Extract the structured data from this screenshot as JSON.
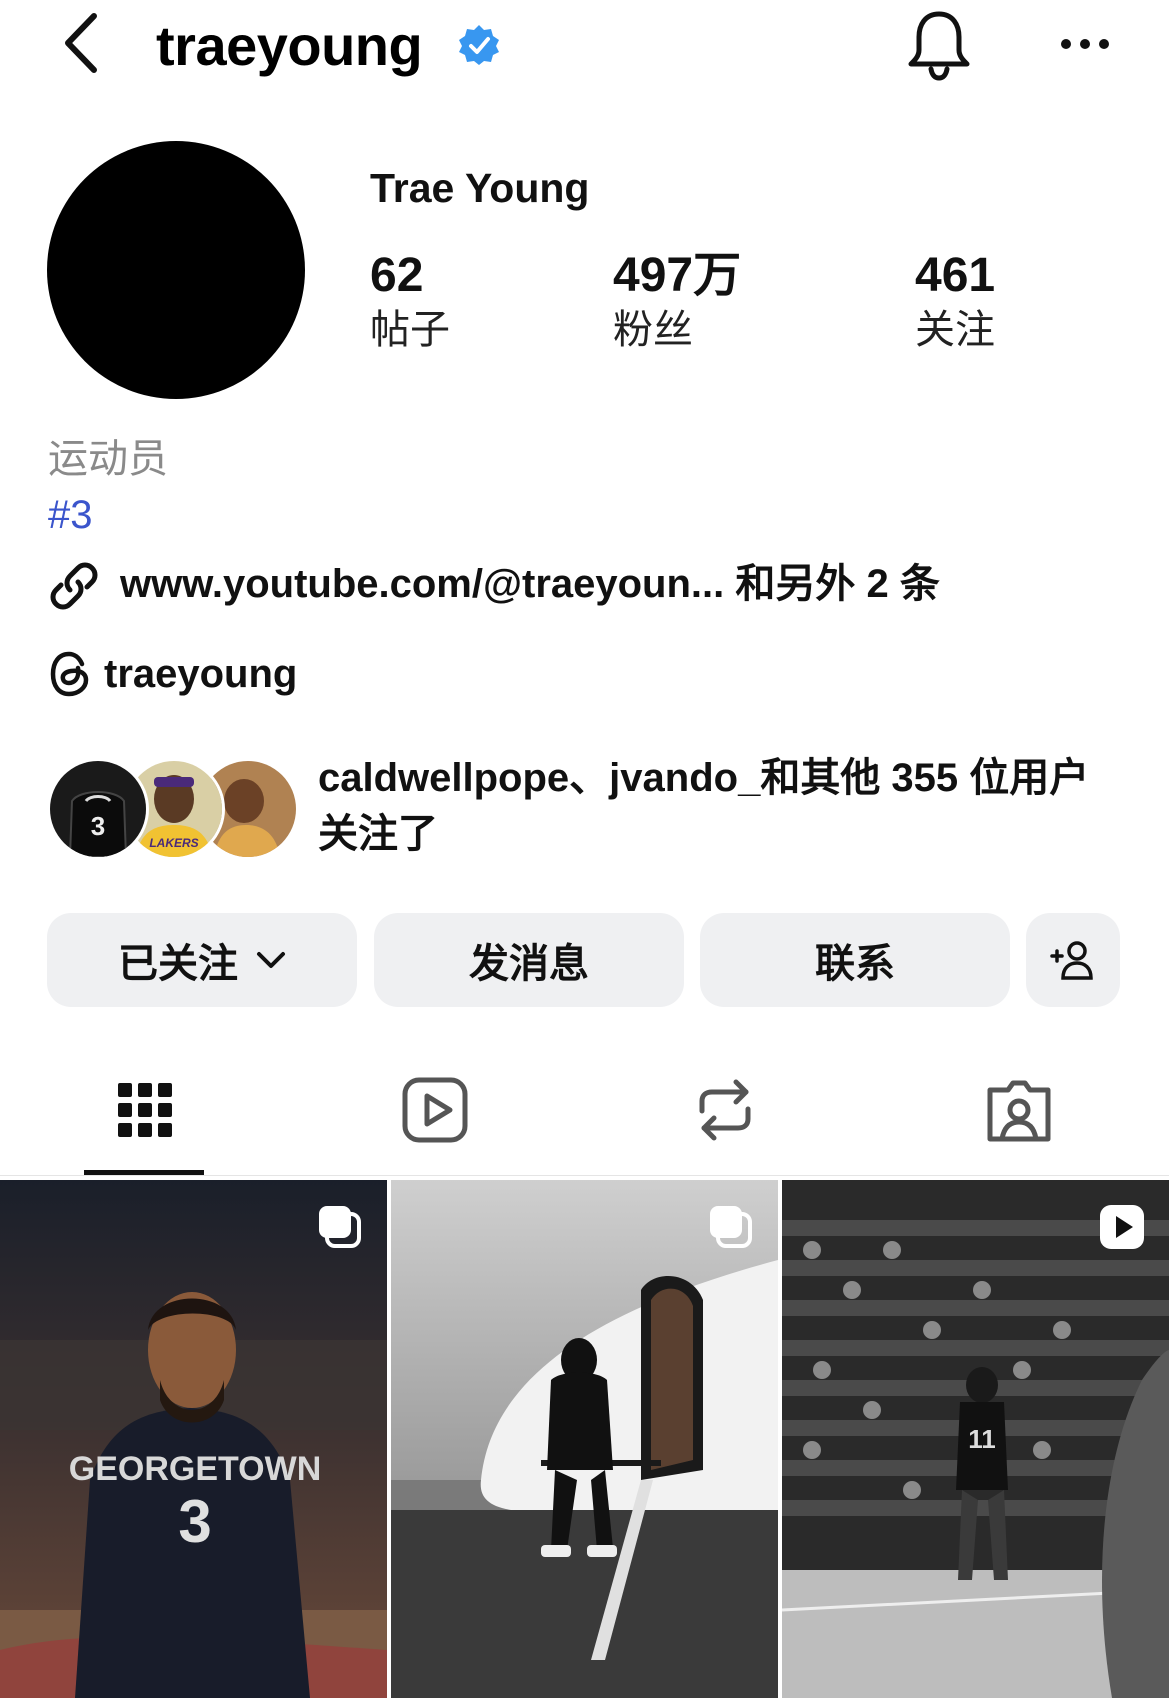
{
  "header": {
    "username": "traeyoung",
    "verified": true,
    "icons": [
      "back-icon",
      "verified-badge-icon",
      "bell-icon",
      "more-icon"
    ]
  },
  "profile": {
    "display_name": "Trae Young",
    "stats": [
      {
        "value": "62",
        "label": "帖子"
      },
      {
        "value": "497万",
        "label": "粉丝"
      },
      {
        "value": "461",
        "label": "关注"
      }
    ],
    "category": "运动员",
    "hashtag": "#3",
    "link_text": "www.youtube.com/@traeyoun... 和另外 2 条",
    "threads_handle": "traeyoung",
    "followed_by_text": "caldwellpope、jvando_和其他 355 位用户关注了"
  },
  "actions": {
    "following_label": "已关注",
    "message_label": "发消息",
    "contact_label": "联系"
  },
  "tabs": [
    "grid-icon",
    "reels-icon",
    "reposts-icon",
    "tagged-icon"
  ],
  "active_tab": 0,
  "colors": {
    "accent_link": "#3b55cc",
    "verified": "#3897f0",
    "button_bg": "#eff0f2",
    "muted_text": "#8a8a8a"
  }
}
